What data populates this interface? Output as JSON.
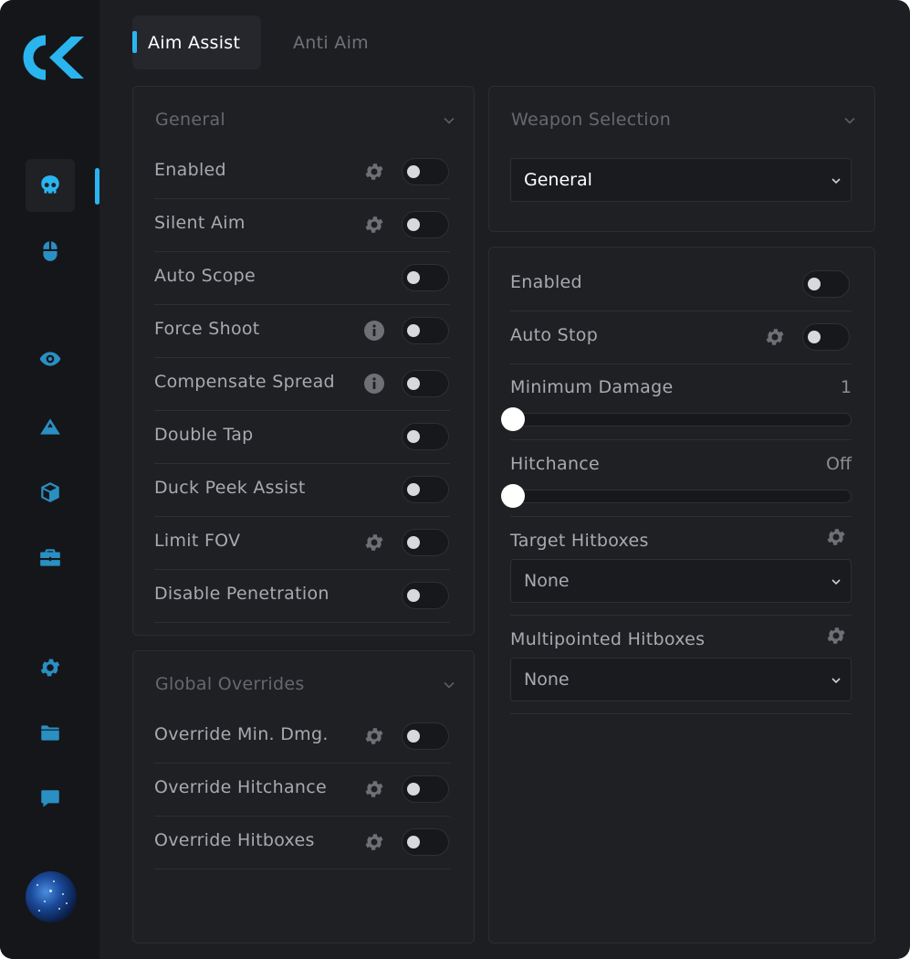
{
  "tabs": [
    {
      "label": "Aim Assist",
      "active": true
    },
    {
      "label": "Anti Aim",
      "active": false
    }
  ],
  "sidebar": {
    "items": [
      {
        "icon": "skull-icon",
        "active": true
      },
      {
        "icon": "mouse-icon"
      },
      {
        "icon": "eye-icon"
      },
      {
        "icon": "mountain-icon"
      },
      {
        "icon": "cube-icon"
      },
      {
        "icon": "briefcase-icon"
      },
      {
        "icon": "gear-icon"
      },
      {
        "icon": "folder-icon"
      },
      {
        "icon": "chat-icon"
      }
    ],
    "accent": "#2ab5f0"
  },
  "general": {
    "title": "General",
    "rows": [
      {
        "label": "Enabled",
        "icon": "gear-icon",
        "on": false
      },
      {
        "label": "Silent Aim",
        "icon": "gear-icon",
        "on": false
      },
      {
        "label": "Auto Scope",
        "icon": "",
        "on": false
      },
      {
        "label": "Force Shoot",
        "icon": "info-icon",
        "on": false
      },
      {
        "label": "Compensate Spread",
        "icon": "info-icon",
        "on": false
      },
      {
        "label": "Double Tap",
        "icon": "",
        "on": false
      },
      {
        "label": "Duck Peek Assist",
        "icon": "",
        "on": false
      },
      {
        "label": "Limit FOV",
        "icon": "gear-icon",
        "on": false
      },
      {
        "label": "Disable Penetration",
        "icon": "",
        "on": false
      }
    ]
  },
  "overrides": {
    "title": "Global Overrides",
    "rows": [
      {
        "label": "Override Min. Dmg.",
        "icon": "gear-icon",
        "on": false
      },
      {
        "label": "Override Hitchance",
        "icon": "gear-icon",
        "on": false
      },
      {
        "label": "Override Hitboxes",
        "icon": "gear-icon",
        "on": false
      }
    ]
  },
  "weapon": {
    "title": "Weapon Selection",
    "selected": "General"
  },
  "weapon_settings": {
    "enabled_label": "Enabled",
    "auto_stop_label": "Auto Stop",
    "min_damage_label": "Minimum Damage",
    "min_damage_value": "1",
    "hitchance_label": "Hitchance",
    "hitchance_value": "Off",
    "target_hitboxes_label": "Target Hitboxes",
    "target_hitboxes_value": "None",
    "multipoint_label": "Multipointed Hitboxes",
    "multipoint_value": "None"
  }
}
